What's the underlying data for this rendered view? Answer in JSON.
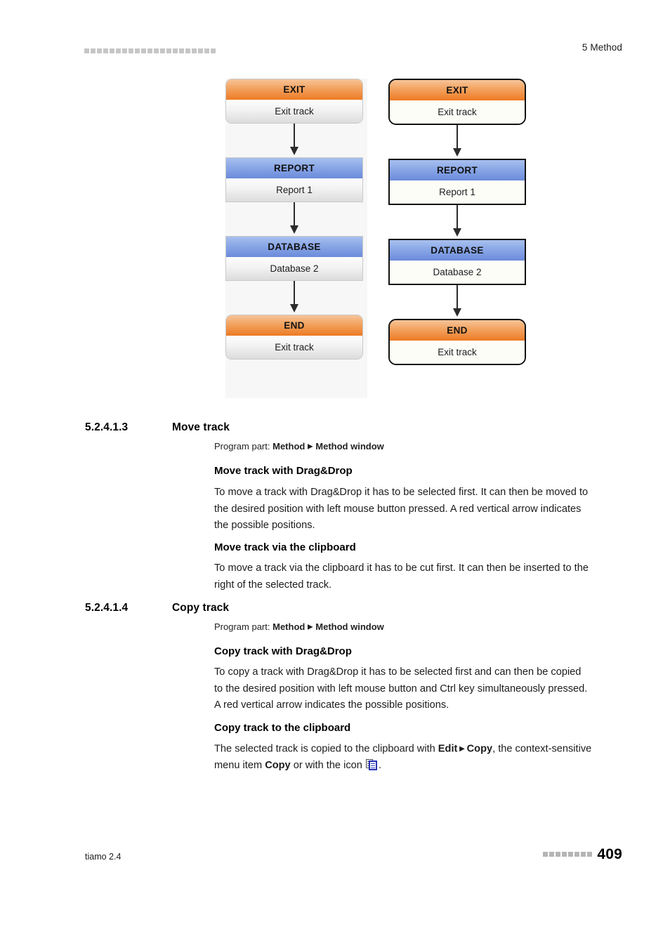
{
  "header": {
    "marker_count": 21,
    "chapter": "5 Method"
  },
  "figure": {
    "columns": [
      {
        "id": "unselected-track",
        "style": "normal",
        "nodes": [
          {
            "title": "EXIT",
            "body": "Exit track",
            "color": "#ee7d28",
            "shape": "rounded"
          },
          {
            "title": "REPORT",
            "body": "Report 1",
            "color": "#6d8ddc",
            "shape": "square"
          },
          {
            "title": "DATABASE",
            "body": "Database 2",
            "color": "#6d8ddc",
            "shape": "square"
          },
          {
            "title": "END",
            "body": "Exit track",
            "color": "#ee7d28",
            "shape": "rounded"
          }
        ]
      },
      {
        "id": "selected-track",
        "style": "selected",
        "nodes": [
          {
            "title": "EXIT",
            "body": "Exit track",
            "color": "#ee7d28",
            "shape": "rounded"
          },
          {
            "title": "REPORT",
            "body": "Report 1",
            "color": "#6d8ddc",
            "shape": "square"
          },
          {
            "title": "DATABASE",
            "body": "Database 2",
            "color": "#6d8ddc",
            "shape": "square"
          },
          {
            "title": "END",
            "body": "Exit track",
            "color": "#ee7d28",
            "shape": "rounded"
          }
        ]
      }
    ]
  },
  "sections": [
    {
      "number": "5.2.4.1.3",
      "title": "Move track",
      "program_part_label": "Program part:",
      "program_part_first": "Method",
      "program_part_second": "Method window",
      "blocks": [
        {
          "heading": "Move track with Drag&Drop",
          "text": "To move a track with Drag&Drop it has to be selected first. It can then be moved to the desired position with left mouse button pressed. A red vertical arrow indicates the possible positions."
        },
        {
          "heading": "Move track via the clipboard",
          "text": "To move a track via the clipboard it has to be cut first. It can then be inserted to the right of the selected track."
        }
      ]
    },
    {
      "number": "5.2.4.1.4",
      "title": "Copy track",
      "program_part_label": "Program part:",
      "program_part_first": "Method",
      "program_part_second": "Method window",
      "blocks": [
        {
          "heading": "Copy track with Drag&Drop",
          "text": "To copy a track with Drag&Drop it has to be selected first and can then be copied to the desired position with left mouse button and Ctrl key simultaneously pressed. A red vertical arrow indicates the possible positions."
        },
        {
          "heading": "Copy track to the clipboard",
          "text_parts": {
            "p1": "The selected track is copied to the clipboard with ",
            "menu1": "Edit",
            "menu2": "Copy",
            "p2": ", the context-sensitive menu item ",
            "menu3": "Copy",
            "p3": " or with the icon ",
            "p4": "."
          }
        }
      ]
    }
  ],
  "footer": {
    "product": "tiamo 2.4",
    "marker_count": 8,
    "page_number": "409"
  }
}
